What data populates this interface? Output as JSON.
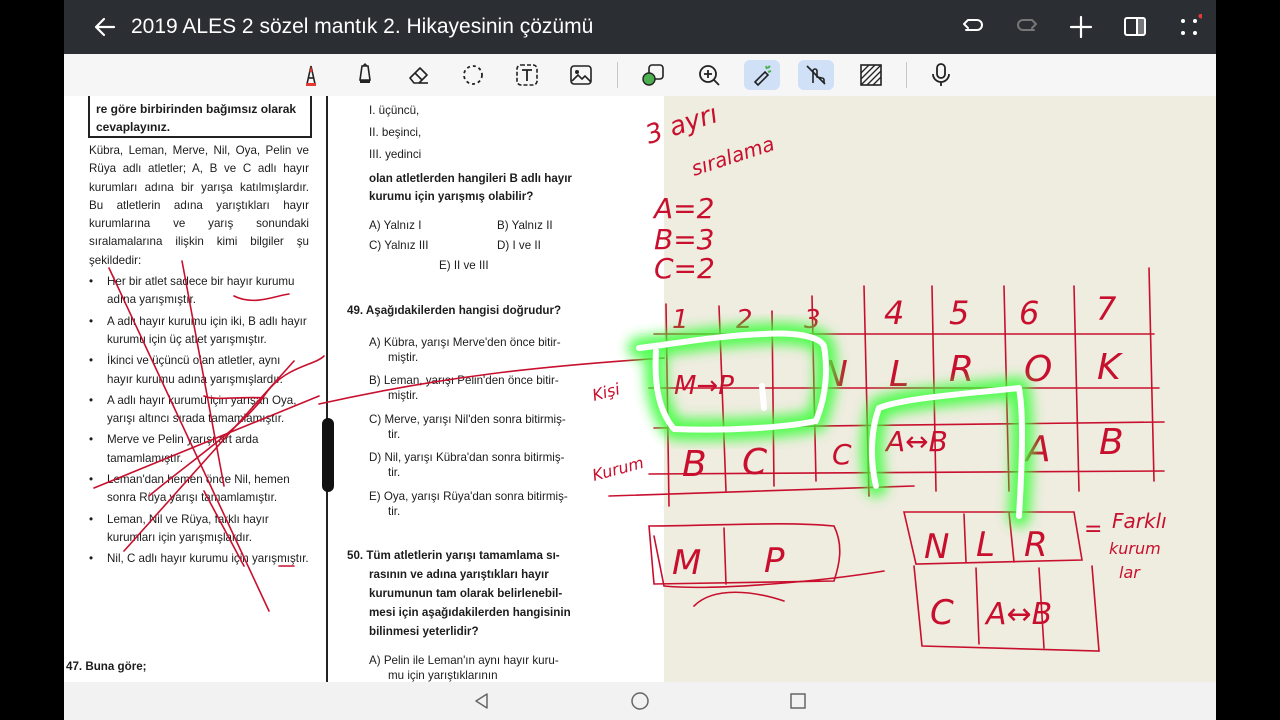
{
  "titlebar": {
    "title": "2019 ALES 2 sözel mantık 2. Hikayesinin çözümü",
    "icons": [
      "back-arrow-icon",
      "undo-icon",
      "redo-icon",
      "add-icon",
      "split-view-icon",
      "more-icon"
    ]
  },
  "toolbar": {
    "tools": [
      "pen-icon",
      "highlighter-icon",
      "eraser-icon",
      "lasso-icon",
      "text-box-icon",
      "image-icon",
      "shape-icon",
      "zoom-icon",
      "laser-pointer-icon",
      "touch-draw-icon",
      "pattern-icon",
      "microphone-icon"
    ],
    "active": [
      "laser-pointer-icon",
      "touch-draw-icon"
    ]
  },
  "doc": {
    "boxed_text": "re göre birbirinden bağımsız olarak cevaplayınız.",
    "intro": "Kübra, Leman, Merve, Nil, Oya, Pelin ve Rüya adlı atletler; A, B ve C adlı hayır kurumları adına bir yarışa katılmışlardır. Bu atletlerin adına yarıştıkları hayır kurumlarına ve yarış sonundaki sıralamalarına ilişkin kimi bilgiler şu şekildedir:",
    "bullets": [
      "Her bir atlet sadece bir hayır kurumu adına yarışmıştır.",
      "A adlı hayır kurumu için iki, B adlı hayır kurumu için üç atlet yarışmıştır.",
      "İkinci ve üçüncü olan atletler, aynı hayır kurumu adına yarışmışlardır.",
      "A adlı hayır kurumu için yarışan Oya, yarışı altıncı sırada tamamlamıştır.",
      "Merve ve Pelin yarışı art arda tamamlamıştır.",
      "Leman'dan hemen önce Nil, hemen sonra Rüya yarışı tamamlamıştır.",
      "Leman, Nil ve Rüya, farklı hayır kurumları için yarışmışlardır.",
      "Nil, C adlı hayır kurumu için yarışmıştır."
    ],
    "q47": "47. Buna göre;",
    "q48_items": [
      "I.   üçüncü,",
      "II.  beşinci,",
      "III. yedinci"
    ],
    "q48_question": [
      "olan atletlerden hangileri B adlı hayır",
      "kurumu için yarışmış olabilir?"
    ],
    "q48_options": {
      "a": "A)  Yalnız I",
      "b": "B)  Yalnız II",
      "c": "C)  Yalnız III",
      "d": "D)  I ve II",
      "e": "E)  II ve III"
    },
    "q49_title": "49. Aşağıdakilerden hangisi doğrudur?",
    "q49_options": [
      [
        "A)  Kübra, yarışı Merve'den önce bitir-",
        "miştir."
      ],
      [
        "B)  Leman, yarışı Pelin'den önce bitir-",
        "miştir."
      ],
      [
        "C)  Merve, yarışı Nil'den sonra bitirmiş-",
        "tir."
      ],
      [
        "D)  Nil, yarışı Kübra'dan sonra bitirmiş-",
        "tir."
      ],
      [
        "E)  Oya, yarışı Rüya'dan sonra bitirmiş-",
        "tir."
      ]
    ],
    "q50_lines": [
      "50. Tüm atletlerin yarışı tamamlama sı-",
      "rasının ve adına yarıştıkları hayır",
      "kurumunun tam olarak belirlenebil-",
      "mesi için aşağıdakilerden hangisinin",
      "bilinmesi yeterlidir?"
    ],
    "q50_option_a": [
      "A)  Pelin ile Leman'ın aynı hayır kuru-",
      "mu için yarıştıklarının"
    ]
  },
  "handwriting": {
    "top_left": [
      "3 ayrı",
      "sıralama"
    ],
    "counts": [
      "A=2",
      "B=3",
      "C=2"
    ],
    "positions": [
      "1",
      "2",
      "3",
      "4",
      "5",
      "6",
      "7"
    ],
    "row_names": [
      "N",
      "L",
      "R",
      "O",
      "K"
    ],
    "row_charities": [
      "B",
      "C",
      "C",
      "A",
      "B"
    ],
    "mp": "M→P",
    "ab": "A↔B",
    "box_mp": [
      "M",
      "P"
    ],
    "box_nlr": [
      "N",
      "L",
      "R"
    ],
    "box_cab": [
      "C",
      "A↔B"
    ],
    "note": [
      "Farklı",
      "kurum",
      "lar"
    ],
    "row_labels": [
      "Kişi",
      "Kurum"
    ]
  },
  "colors": {
    "ink": "#c8102e",
    "laser": "#2ee82e",
    "titlebar": "#2b2e33",
    "paper": "#efece0"
  },
  "navbar": {
    "icons": [
      "nav-back-icon",
      "nav-home-icon",
      "nav-recent-icon"
    ]
  }
}
